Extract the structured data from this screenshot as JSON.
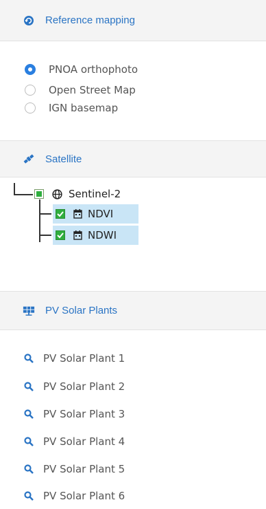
{
  "reference": {
    "title": "Reference mapping",
    "icon": "globe-arrow-icon",
    "options": [
      {
        "label": "PNOA orthophoto",
        "checked": true
      },
      {
        "label": "Open Street Map",
        "checked": false
      },
      {
        "label": "IGN basemap",
        "checked": false
      }
    ]
  },
  "satellite": {
    "title": "Satellite",
    "icon": "satellite-icon",
    "root": {
      "label": "Sentinel-2",
      "state": "partial"
    },
    "children": [
      {
        "label": "NDVI",
        "checked": true,
        "icon": "calendar-icon"
      },
      {
        "label": "NDWI",
        "checked": true,
        "icon": "calendar-icon"
      }
    ]
  },
  "pv": {
    "title": "PV Solar Plants",
    "icon": "solar-panel-icon",
    "items": [
      "PV Solar Plant 1",
      "PV Solar Plant 2",
      "PV Solar Plant 3",
      "PV Solar Plant 4",
      "PV Solar Plant 5",
      "PV Solar Plant 6"
    ]
  },
  "colors": {
    "accent": "#2a74c4",
    "check_green": "#2fae3e",
    "selection": "#c9e5f6"
  }
}
